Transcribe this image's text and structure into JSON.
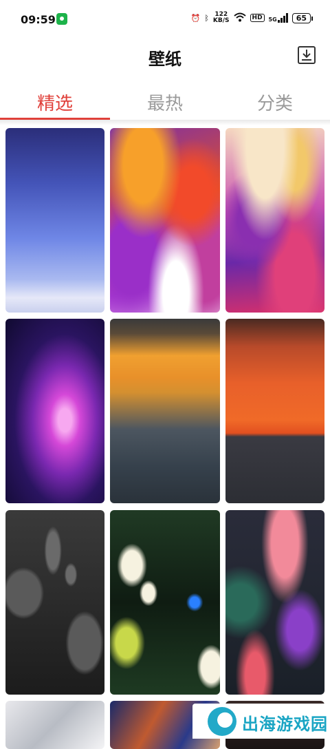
{
  "status_bar": {
    "time": "09:59",
    "net_speed_value": "122",
    "net_speed_unit": "KB/S",
    "hd": "HD",
    "network": "5G",
    "battery": "65"
  },
  "header": {
    "title": "壁纸"
  },
  "tabs": [
    {
      "label": "精选",
      "active": true
    },
    {
      "label": "最热",
      "active": false
    },
    {
      "label": "分类",
      "active": false
    }
  ],
  "wallpapers": [
    {
      "name": "blue-gradient-wallpaper"
    },
    {
      "name": "fluid-orange-purple-wallpaper"
    },
    {
      "name": "fluid-pink-purple-wallpaper"
    },
    {
      "name": "purple-nebula-wallpaper"
    },
    {
      "name": "sunset-clouds-wallpaper"
    },
    {
      "name": "red-sea-sunset-wallpaper"
    },
    {
      "name": "water-drops-wallpaper"
    },
    {
      "name": "tropical-flowers-butterfly-wallpaper"
    },
    {
      "name": "botanical-illustration-wallpaper"
    },
    {
      "name": "silver-wave-wallpaper"
    },
    {
      "name": "abstract-swirl-wallpaper"
    },
    {
      "name": "dark-wallpaper"
    }
  ],
  "watermark": {
    "text": "出海游戏园"
  },
  "colors": {
    "accent": "#e0403a",
    "tab_inactive": "#9a9a9a",
    "watermark": "#1aa5c4"
  }
}
